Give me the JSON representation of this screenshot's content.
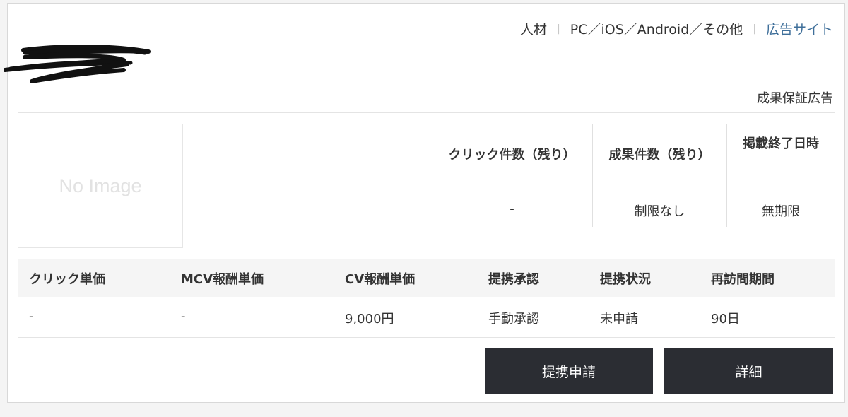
{
  "header": {
    "tags": [
      "人材",
      "PC／iOS／Android／その他"
    ],
    "site_link": "広告サイト",
    "badge": "成果保証広告"
  },
  "image_placeholder": "No Image",
  "stats": [
    {
      "label": "クリック件数（残り）",
      "value": "-"
    },
    {
      "label": "成果件数（残り）",
      "value": "制限なし"
    },
    {
      "label": "掲載終了日時",
      "value": "無期限"
    }
  ],
  "table": {
    "headers": [
      "クリック単価",
      "MCV報酬単価",
      "CV報酬単価",
      "提携承認",
      "提携状況",
      "再訪問期間"
    ],
    "values": [
      "-",
      "-",
      "9,000円",
      "手動承認",
      "未申請",
      "90日"
    ]
  },
  "buttons": {
    "apply": "提携申請",
    "detail": "詳細"
  }
}
